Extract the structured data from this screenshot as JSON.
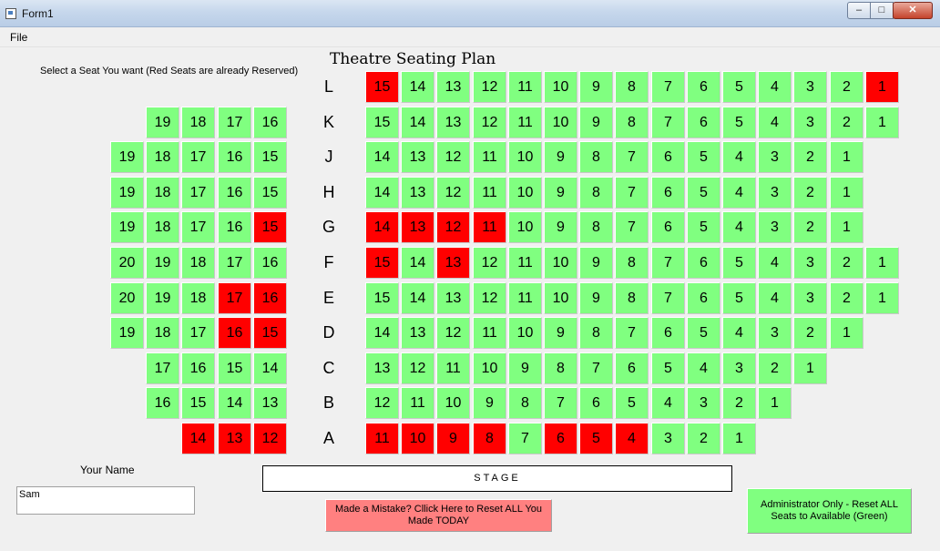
{
  "window": {
    "title": "Form1",
    "minimize_glyph": "–",
    "maximize_glyph": "□",
    "close_glyph": "✕"
  },
  "menu": {
    "file": "File"
  },
  "plan_title": "Theatre Seating Plan",
  "instructions": "Select a Seat You want (Red Seats are already Reserved)",
  "colors": {
    "available": "#80ff80",
    "reserved": "#ff0000",
    "reset_button": "#ff8080"
  },
  "rows": [
    {
      "label": "L",
      "left": [],
      "right": [
        {
          "n": "15",
          "reserved": true
        },
        {
          "n": "14"
        },
        {
          "n": "13"
        },
        {
          "n": "12"
        },
        {
          "n": "11"
        },
        {
          "n": "10"
        },
        {
          "n": "9"
        },
        {
          "n": "8"
        },
        {
          "n": "7"
        },
        {
          "n": "6"
        },
        {
          "n": "5"
        },
        {
          "n": "4"
        },
        {
          "n": "3"
        },
        {
          "n": "2"
        },
        {
          "n": "1",
          "reserved": true
        }
      ]
    },
    {
      "label": "K",
      "left": [
        {
          "n": "19"
        },
        {
          "n": "18"
        },
        {
          "n": "17"
        },
        {
          "n": "16"
        }
      ],
      "right": [
        {
          "n": "15"
        },
        {
          "n": "14"
        },
        {
          "n": "13"
        },
        {
          "n": "12"
        },
        {
          "n": "11"
        },
        {
          "n": "10"
        },
        {
          "n": "9"
        },
        {
          "n": "8"
        },
        {
          "n": "7"
        },
        {
          "n": "6"
        },
        {
          "n": "5"
        },
        {
          "n": "4"
        },
        {
          "n": "3"
        },
        {
          "n": "2"
        },
        {
          "n": "1"
        }
      ]
    },
    {
      "label": "J",
      "left": [
        {
          "n": "19"
        },
        {
          "n": "18"
        },
        {
          "n": "17"
        },
        {
          "n": "16"
        },
        {
          "n": "15"
        }
      ],
      "right": [
        {
          "n": "14"
        },
        {
          "n": "13"
        },
        {
          "n": "12"
        },
        {
          "n": "11"
        },
        {
          "n": "10"
        },
        {
          "n": "9"
        },
        {
          "n": "8"
        },
        {
          "n": "7"
        },
        {
          "n": "6"
        },
        {
          "n": "5"
        },
        {
          "n": "4"
        },
        {
          "n": "3"
        },
        {
          "n": "2"
        },
        {
          "n": "1"
        }
      ]
    },
    {
      "label": "H",
      "left": [
        {
          "n": "19"
        },
        {
          "n": "18"
        },
        {
          "n": "17"
        },
        {
          "n": "16"
        },
        {
          "n": "15"
        }
      ],
      "right": [
        {
          "n": "14"
        },
        {
          "n": "13"
        },
        {
          "n": "12"
        },
        {
          "n": "11"
        },
        {
          "n": "10"
        },
        {
          "n": "9"
        },
        {
          "n": "8"
        },
        {
          "n": "7"
        },
        {
          "n": "6"
        },
        {
          "n": "5"
        },
        {
          "n": "4"
        },
        {
          "n": "3"
        },
        {
          "n": "2"
        },
        {
          "n": "1"
        }
      ]
    },
    {
      "label": "G",
      "left": [
        {
          "n": "19"
        },
        {
          "n": "18"
        },
        {
          "n": "17"
        },
        {
          "n": "16"
        },
        {
          "n": "15",
          "reserved": true
        }
      ],
      "right": [
        {
          "n": "14",
          "reserved": true
        },
        {
          "n": "13",
          "reserved": true
        },
        {
          "n": "12",
          "reserved": true
        },
        {
          "n": "11",
          "reserved": true
        },
        {
          "n": "10"
        },
        {
          "n": "9"
        },
        {
          "n": "8"
        },
        {
          "n": "7"
        },
        {
          "n": "6"
        },
        {
          "n": "5"
        },
        {
          "n": "4"
        },
        {
          "n": "3"
        },
        {
          "n": "2"
        },
        {
          "n": "1"
        }
      ]
    },
    {
      "label": "F",
      "left": [
        {
          "n": "20"
        },
        {
          "n": "19"
        },
        {
          "n": "18"
        },
        {
          "n": "17"
        },
        {
          "n": "16"
        }
      ],
      "right": [
        {
          "n": "15",
          "reserved": true
        },
        {
          "n": "14"
        },
        {
          "n": "13",
          "reserved": true
        },
        {
          "n": "12"
        },
        {
          "n": "11"
        },
        {
          "n": "10"
        },
        {
          "n": "9"
        },
        {
          "n": "8"
        },
        {
          "n": "7"
        },
        {
          "n": "6"
        },
        {
          "n": "5"
        },
        {
          "n": "4"
        },
        {
          "n": "3"
        },
        {
          "n": "2"
        },
        {
          "n": "1"
        }
      ]
    },
    {
      "label": "E",
      "left": [
        {
          "n": "20"
        },
        {
          "n": "19"
        },
        {
          "n": "18"
        },
        {
          "n": "17",
          "reserved": true
        },
        {
          "n": "16",
          "reserved": true
        }
      ],
      "right": [
        {
          "n": "15"
        },
        {
          "n": "14"
        },
        {
          "n": "13"
        },
        {
          "n": "12"
        },
        {
          "n": "11"
        },
        {
          "n": "10"
        },
        {
          "n": "9"
        },
        {
          "n": "8"
        },
        {
          "n": "7"
        },
        {
          "n": "6"
        },
        {
          "n": "5"
        },
        {
          "n": "4"
        },
        {
          "n": "3"
        },
        {
          "n": "2"
        },
        {
          "n": "1"
        }
      ]
    },
    {
      "label": "D",
      "left": [
        {
          "n": "19"
        },
        {
          "n": "18"
        },
        {
          "n": "17"
        },
        {
          "n": "16",
          "reserved": true
        },
        {
          "n": "15",
          "reserved": true
        }
      ],
      "right": [
        {
          "n": "14"
        },
        {
          "n": "13"
        },
        {
          "n": "12"
        },
        {
          "n": "11"
        },
        {
          "n": "10"
        },
        {
          "n": "9"
        },
        {
          "n": "8"
        },
        {
          "n": "7"
        },
        {
          "n": "6"
        },
        {
          "n": "5"
        },
        {
          "n": "4"
        },
        {
          "n": "3"
        },
        {
          "n": "2"
        },
        {
          "n": "1"
        }
      ]
    },
    {
      "label": "C",
      "left": [
        {
          "n": "17"
        },
        {
          "n": "16"
        },
        {
          "n": "15"
        },
        {
          "n": "14"
        }
      ],
      "right": [
        {
          "n": "13"
        },
        {
          "n": "12"
        },
        {
          "n": "11"
        },
        {
          "n": "10"
        },
        {
          "n": "9"
        },
        {
          "n": "8"
        },
        {
          "n": "7"
        },
        {
          "n": "6"
        },
        {
          "n": "5"
        },
        {
          "n": "4"
        },
        {
          "n": "3"
        },
        {
          "n": "2"
        },
        {
          "n": "1"
        }
      ]
    },
    {
      "label": "B",
      "left": [
        {
          "n": "16"
        },
        {
          "n": "15"
        },
        {
          "n": "14"
        },
        {
          "n": "13"
        }
      ],
      "right": [
        {
          "n": "12"
        },
        {
          "n": "11"
        },
        {
          "n": "10"
        },
        {
          "n": "9"
        },
        {
          "n": "8"
        },
        {
          "n": "7"
        },
        {
          "n": "6"
        },
        {
          "n": "5"
        },
        {
          "n": "4"
        },
        {
          "n": "3"
        },
        {
          "n": "2"
        },
        {
          "n": "1"
        }
      ]
    },
    {
      "label": "A",
      "left": [
        {
          "n": "14",
          "reserved": true
        },
        {
          "n": "13",
          "reserved": true
        },
        {
          "n": "12",
          "reserved": true
        }
      ],
      "right": [
        {
          "n": "11",
          "reserved": true
        },
        {
          "n": "10",
          "reserved": true
        },
        {
          "n": "9",
          "reserved": true
        },
        {
          "n": "8",
          "reserved": true
        },
        {
          "n": "7"
        },
        {
          "n": "6",
          "reserved": true
        },
        {
          "n": "5",
          "reserved": true
        },
        {
          "n": "4",
          "reserved": true
        },
        {
          "n": "3"
        },
        {
          "n": "2"
        },
        {
          "n": "1"
        }
      ]
    }
  ],
  "your_name": {
    "label": "Your Name",
    "value": "Sam"
  },
  "stage_label": "STAGE",
  "reset_mine_button": "Made a Mistake?  Cllick Here to Reset ALL You Made TODAY",
  "admin_reset_button": "Administrator Only - Reset ALL Seats to Available (Green)"
}
